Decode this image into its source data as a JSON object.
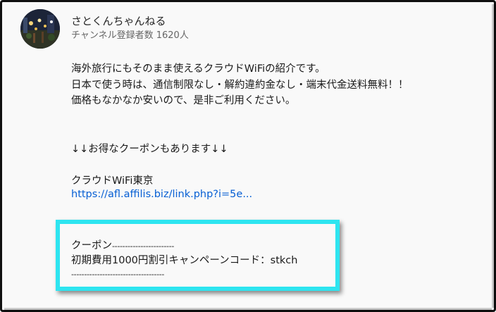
{
  "channel": {
    "name": "さとくんちゃんねる",
    "subscribers": "チャンネル登録者数 1620人"
  },
  "description": {
    "line1": "海外旅行にもそのまま使えるクラウドWiFiの紹介です。",
    "line2": "日本で使う時は、通信制限なし・解約違約金なし・端末代金送料無料！！",
    "line3": "価格もなかなか安いので、是非ご利用ください。",
    "coupon_note": "↓↓お得なクーポンもあります↓↓",
    "shop_name": "クラウドWiFi東京",
    "shop_link": "https://afl.affilis.biz/link.php?i=5e..."
  },
  "coupon": {
    "header_label": "クーポン",
    "header_dashes": "------------------------",
    "code_line": "初期費用1000円割引キャンペーンコード：stkch",
    "footer_dashes": "------------------------------------"
  },
  "colors": {
    "link": "#065fd4",
    "highlight": "#2ee5f0",
    "background": "#f9f9f9"
  },
  "icons": {
    "avatar": "channel-avatar-night-street-photo"
  }
}
